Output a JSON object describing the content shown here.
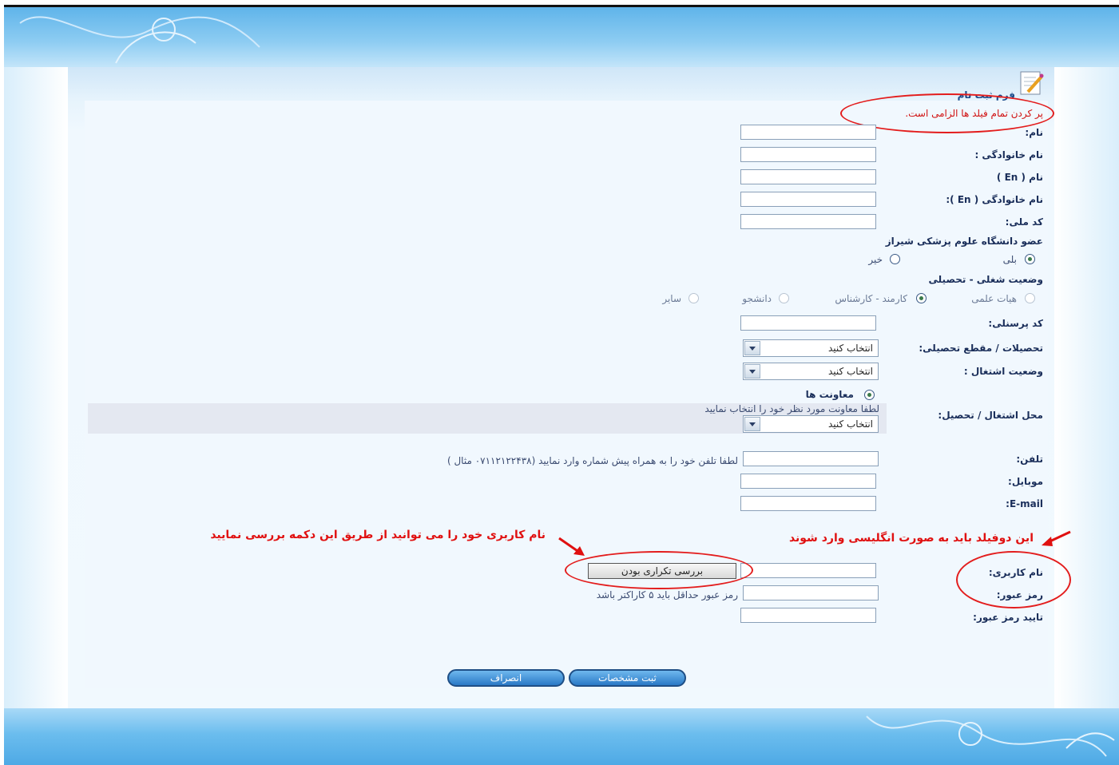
{
  "form": {
    "title": "فرم ثبت نام",
    "required_note": "پر کردن تمام فیلد ها الزامی است.",
    "fields": {
      "first_name": "نام:",
      "last_name": "نام خانوادگی :",
      "first_name_en": "نام ( En )",
      "last_name_en": "نام خانوادگی ( En ):",
      "national_code": "کد ملی:",
      "member_question": "عضو دانشگاه علوم پزشکی شیراز",
      "member_yes": "بلی",
      "member_no": "خیر",
      "job_status": "وضعیت شغلی - تحصیلی",
      "job_faculty": "هیات علمی",
      "job_staff": "کارمند - کارشناس",
      "job_student": "دانشجو",
      "job_other": "سایر",
      "personnel_code": "کد پرسنلی:",
      "education": "تحصیلات / مقطع تحصیلی:",
      "employment_status": "وضعیت اشتغال :",
      "select_placeholder": "انتخاب کنید",
      "deputies": "معاونت ها",
      "deputy_hint": "لطفا معاونت مورد نظر خود را انتخاب نمایید",
      "workplace": "محل اشتغال / تحصیل:",
      "phone": "تلفن:",
      "phone_hint": "لطفا تلفن خود را به همراه پیش شماره وارد نمایید (۰۷۱۱۲۱۲۲۴۳۸ مثال )",
      "mobile": "موبایل:",
      "email": "E-mail:",
      "username": "نام کاربری:",
      "check_duplicate": "بررسی تکراری بودن",
      "password": "رمز عبور:",
      "password_hint": "رمز عبور حداقل باید ۵ کاراکتر باشد",
      "confirm_password": "تایید رمز عبور:"
    },
    "buttons": {
      "submit": "ثبت مشخصات",
      "cancel": "انصراف"
    }
  },
  "annotations": {
    "english_fields_note": "این دوفیلد باید به صورت انگلیسی وارد شوند",
    "check_button_note": "نام کاربری خود را می توانید از طریق این دکمه بررسی نمایید"
  },
  "colors": {
    "annotation": "#e01010",
    "label": "#1a2e5a",
    "button": "#2a79c6"
  }
}
